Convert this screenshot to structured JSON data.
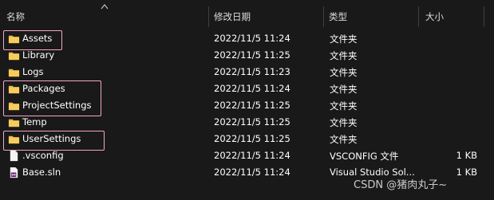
{
  "header": {
    "name": "名称",
    "modified": "修改日期",
    "type": "类型",
    "size": "大小"
  },
  "rows": [
    {
      "name": "Assets",
      "date": "2022/11/5 11:24",
      "type": "文件夹",
      "size": "",
      "icon": "folder-icon"
    },
    {
      "name": "Library",
      "date": "2022/11/5 11:25",
      "type": "文件夹",
      "size": "",
      "icon": "folder-icon"
    },
    {
      "name": "Logs",
      "date": "2022/11/5 11:23",
      "type": "文件夹",
      "size": "",
      "icon": "folder-icon"
    },
    {
      "name": "Packages",
      "date": "2022/11/5 11:24",
      "type": "文件夹",
      "size": "",
      "icon": "folder-icon"
    },
    {
      "name": "ProjectSettings",
      "date": "2022/11/5 11:25",
      "type": "文件夹",
      "size": "",
      "icon": "folder-icon"
    },
    {
      "name": "Temp",
      "date": "2022/11/5 11:25",
      "type": "文件夹",
      "size": "",
      "icon": "folder-icon"
    },
    {
      "name": "UserSettings",
      "date": "2022/11/5 11:25",
      "type": "文件夹",
      "size": "",
      "icon": "folder-icon"
    },
    {
      "name": ".vsconfig",
      "date": "2022/11/5 11:24",
      "type": "VSCONFIG 文件",
      "size": "1 KB",
      "icon": "file-icon"
    },
    {
      "name": "Base.sln",
      "date": "2022/11/5 11:24",
      "type": "Visual Studio Sol...",
      "size": "1 KB",
      "icon": "sln-file-icon"
    }
  ],
  "watermark": "CSDN @猪肉丸子~",
  "colors": {
    "background": "#191919",
    "folder": "#e8b84a",
    "highlight": "#f3a7c8",
    "text": "#ffffff"
  }
}
